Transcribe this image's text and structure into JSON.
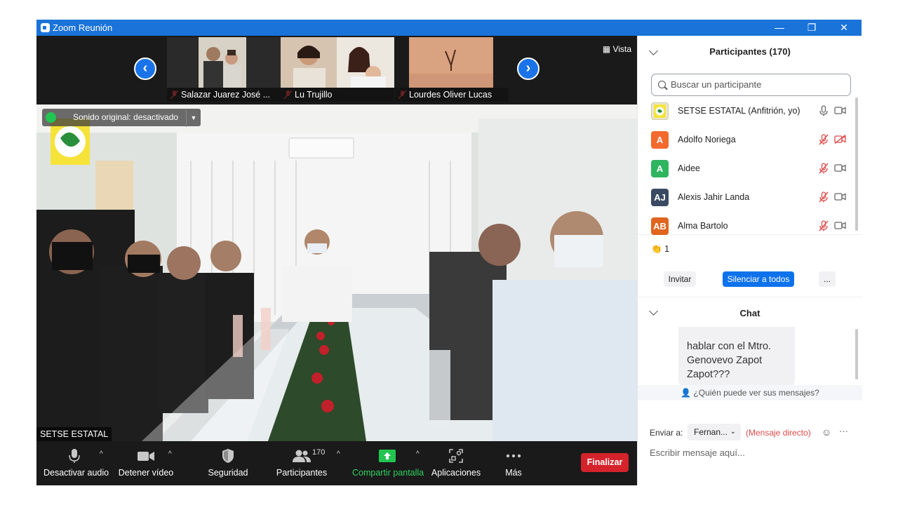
{
  "window": {
    "title": "Zoom Reunión",
    "controls": [
      "—",
      "❐",
      "✕"
    ]
  },
  "strip": {
    "thumbnails": [
      {
        "name": "Salazar Juarez José ..."
      },
      {
        "name": "Lu Trujillo"
      },
      {
        "name": "Lourdes Oliver Lucas"
      }
    ],
    "view_label": "Vista"
  },
  "video": {
    "original_sound": "Sonido original: desactivado",
    "speaker": "SETSE ESTATAL"
  },
  "controls": {
    "audio": "Desactivar audio",
    "video": "Detener vídeo",
    "security": "Seguridad",
    "participants": "Participantes",
    "participants_count": "170",
    "share": "Compartir pantalla",
    "apps": "Aplicaciones",
    "more": "Más",
    "end": "Finalizar"
  },
  "participants_panel": {
    "title": "Participantes (170)",
    "search_placeholder": "Buscar un participante",
    "participants": [
      {
        "name": "SETSE ESTATAL (Anfitrión, yo)",
        "initials": "",
        "color": "#e8e6d5",
        "muted": false,
        "video_off": false
      },
      {
        "name": "Adolfo Noriega",
        "initials": "A",
        "color": "#f26a2e",
        "muted": true,
        "video_off": true
      },
      {
        "name": "Aidee",
        "initials": "A",
        "color": "#2fb560",
        "muted": true,
        "video_off": false
      },
      {
        "name": "Alexis Jahir Landa",
        "initials": "AJ",
        "color": "#3a4a63",
        "muted": true,
        "video_off": false
      },
      {
        "name": "Alma Bartolo",
        "initials": "AB",
        "color": "#e0651f",
        "muted": true,
        "video_off": false
      }
    ],
    "reaction_count": "1",
    "invite": "Invitar",
    "mute_all": "Silenciar a todos",
    "more": "..."
  },
  "chat_panel": {
    "title": "Chat",
    "message": "hablar con el Mtro. Genovevo Zapot Zapot???",
    "who_can_see": "¿Quién puede ver sus mensajes?",
    "send_to_label": "Enviar a:",
    "recipient": "Fernan...",
    "direct_message": "(Mensaje directo)",
    "compose_placeholder": "Escribir mensaje aquí..."
  },
  "colors": {
    "titlebar": "#1a73d9",
    "end_button": "#d4232b",
    "mute_all_button": "#0e72ed",
    "share_green": "#23c552",
    "muted_red": "#e04a4a"
  }
}
